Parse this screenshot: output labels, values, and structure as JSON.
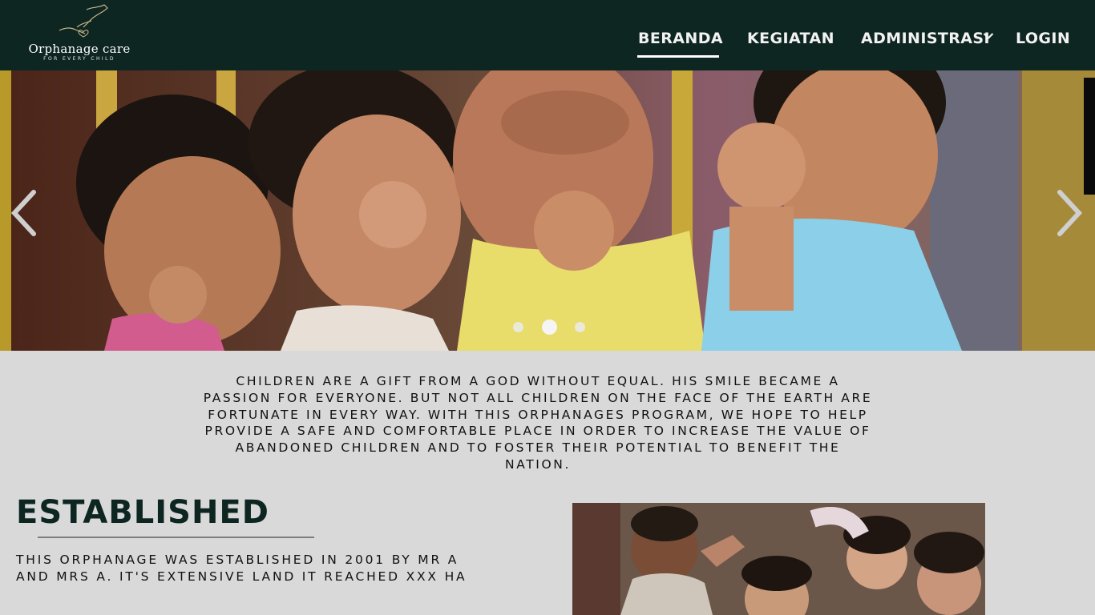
{
  "brand": {
    "name": "Orphanage care",
    "tagline": "FOR EVERY CHILD",
    "logo_icon": "hands-heart-icon"
  },
  "nav": {
    "items": [
      {
        "label": "BERANDA",
        "active": true
      },
      {
        "label": "KEGIATAN",
        "active": false
      },
      {
        "label": "ADMINISTRASI",
        "active": false,
        "has_dropdown": true
      },
      {
        "label": "LOGIN",
        "active": false
      }
    ],
    "dropdown_icon": "chevron-down-icon"
  },
  "carousel": {
    "image": "laughing-children-pointing-photo",
    "prev_icon": "chevron-left-icon",
    "next_icon": "chevron-right-icon",
    "slide_count": 3,
    "active_slide": 2
  },
  "intro": {
    "text": "CHILDREN ARE A GIFT FROM A GOD WITHOUT EQUAL. HIS SMILE BECAME A PASSION FOR EVERYONE. BUT NOT ALL CHILDREN ON THE FACE OF THE EARTH ARE FORTUNATE IN EVERY WAY. WITH THIS ORPHANAGES PROGRAM, WE HOPE TO HELP PROVIDE A SAFE AND COMFORTABLE PLACE IN ORDER TO INCREASE THE VALUE OF ABANDONED CHILDREN AND TO FOSTER THEIR POTENTIAL TO BENEFIT THE NATION."
  },
  "established": {
    "title": "ESTABLISHED",
    "text": "THIS ORPHANAGE WAS ESTABLISHED IN 2001 BY MR A AND MRS A. IT'S EXTENSIVE LAND IT REACHED XXX HA",
    "image": "children-group-photo"
  },
  "colors": {
    "nav_bg": "#0e2622",
    "page_bg": "#d9d9d9",
    "heading": "#0e2622"
  }
}
